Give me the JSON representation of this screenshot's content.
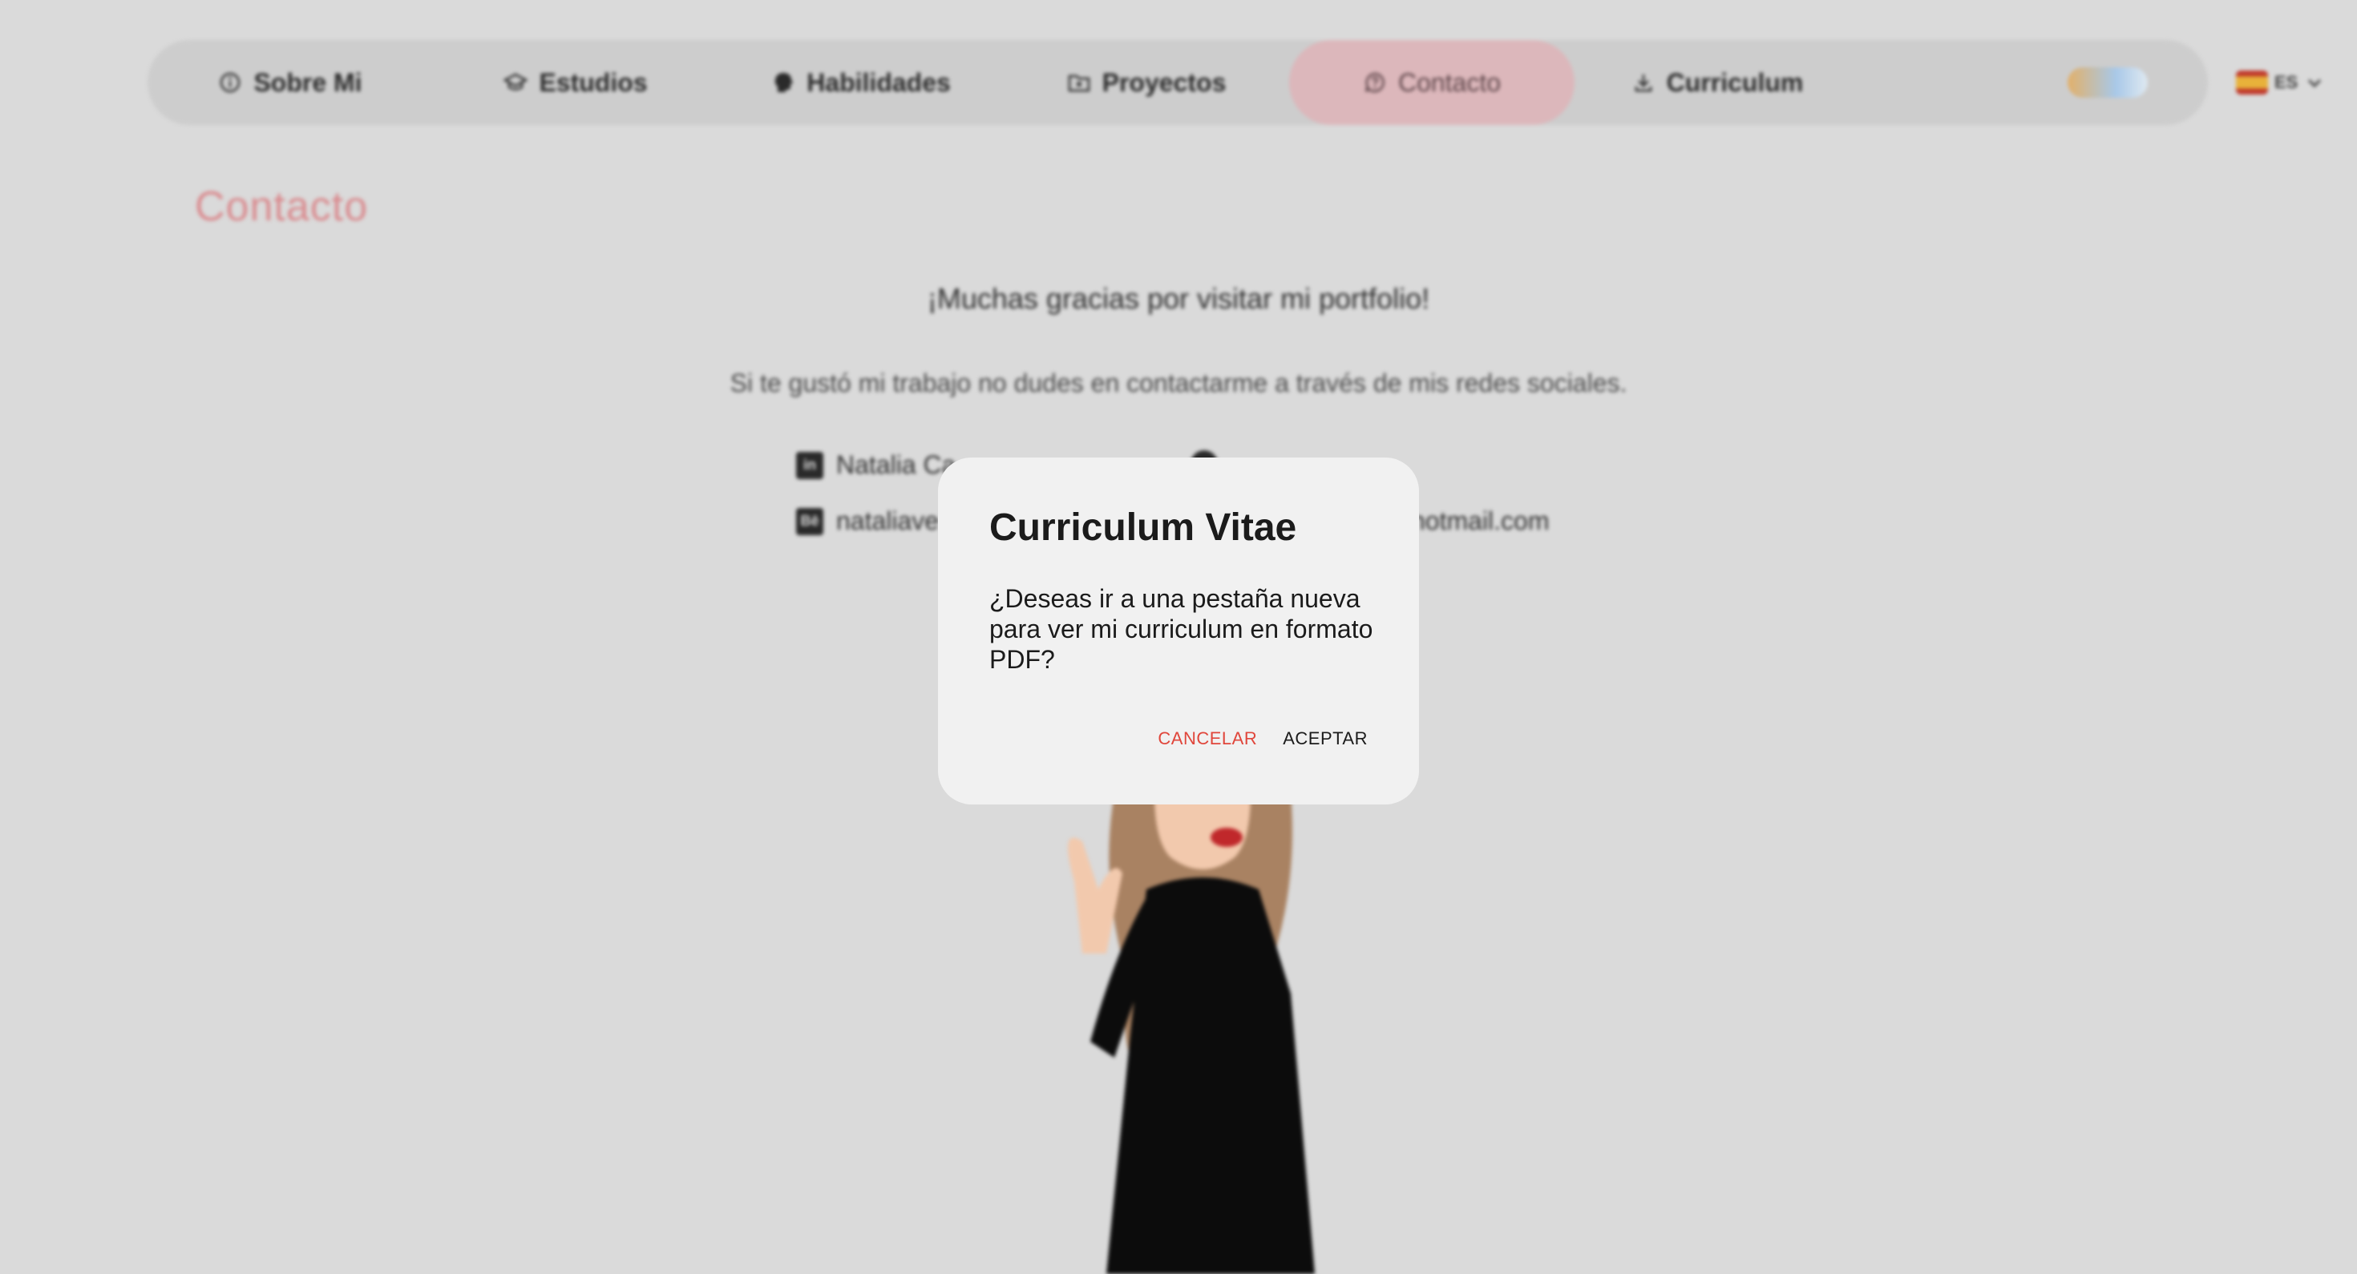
{
  "nav": {
    "items": [
      {
        "label": "Sobre Mi",
        "icon": "info-circle-icon"
      },
      {
        "label": "Estudios",
        "icon": "graduation-cap-icon"
      },
      {
        "label": "Habilidades",
        "icon": "brain-head-icon"
      },
      {
        "label": "Proyectos",
        "icon": "folder-icon"
      },
      {
        "label": "Contacto",
        "icon": "question-chat-icon",
        "active": true
      },
      {
        "label": "Curriculum",
        "icon": "download-icon"
      }
    ],
    "theme_toggle": "sun-cloud-toggle",
    "language": {
      "code": "ES",
      "flag": "spain-flag-icon"
    }
  },
  "page": {
    "title": "Contacto",
    "thanks": "¡Muchas gracias por visitar mi portfolio!",
    "subtitle": "Si te gustó mi trabajo no dudes en contactarme a través de mis redes sociales.",
    "contacts": {
      "linkedin": "Natalia Ca",
      "behance": "nataliave",
      "email_suffix": "hotmail.com"
    }
  },
  "modal": {
    "title": "Curriculum Vitae",
    "body": "¿Deseas ir a una pestaña nueva para ver mi curriculum en formato PDF?",
    "cancel": "CANCELAR",
    "accept": "ACEPTAR"
  },
  "colors": {
    "accent": "#d98a8e",
    "cancel": "#e0463b",
    "background": "#dadada"
  }
}
